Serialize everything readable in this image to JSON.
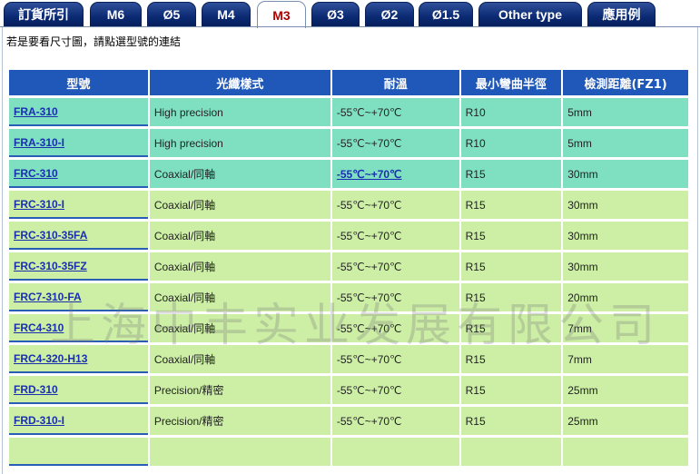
{
  "tabs": [
    {
      "label": "訂貨所引",
      "active": false
    },
    {
      "label": "M6",
      "active": false
    },
    {
      "label": "Ø5",
      "active": false
    },
    {
      "label": "M4",
      "active": false
    },
    {
      "label": "M3",
      "active": true
    },
    {
      "label": "Ø3",
      "active": false
    },
    {
      "label": "Ø2",
      "active": false
    },
    {
      "label": "Ø1.5",
      "active": false
    },
    {
      "label": "Other type",
      "active": false
    },
    {
      "label": "應用例",
      "active": false
    }
  ],
  "instruction": "若是要看尺寸圖，請點選型號的連結",
  "table": {
    "headers": [
      "型號",
      "光纖樣式",
      "耐溫",
      "最小彎曲半徑",
      "檢測距離(FZ1)"
    ],
    "rows": [
      {
        "model": "FRA-310",
        "fiber": "High precision",
        "temp": "-55℃~+70℃",
        "bend": "R10",
        "dist": "5mm"
      },
      {
        "model": "FRA-310-I",
        "fiber": "High precision",
        "temp": "-55℃~+70℃",
        "bend": "R10",
        "dist": "5mm"
      },
      {
        "model": "FRC-310",
        "fiber": "Coaxial/同軸",
        "temp": "-55℃~+70℃",
        "bend": "R15",
        "dist": "30mm"
      },
      {
        "model": "FRC-310-I",
        "fiber": "Coaxial/同軸",
        "temp": "-55℃~+70℃",
        "bend": "R15",
        "dist": "30mm"
      },
      {
        "model": "FRC-310-35FA",
        "fiber": "Coaxial/同軸",
        "temp": "-55℃~+70℃",
        "bend": "R15",
        "dist": "30mm"
      },
      {
        "model": "FRC-310-35FZ",
        "fiber": "Coaxial/同軸",
        "temp": "-55℃~+70℃",
        "bend": "R15",
        "dist": "30mm"
      },
      {
        "model": "FRC7-310-FA",
        "fiber": "Coaxial/同軸",
        "temp": "-55℃~+70℃",
        "bend": "R15",
        "dist": "20mm"
      },
      {
        "model": "FRC4-310",
        "fiber": "Coaxial/同軸",
        "temp": "-55℃~+70℃",
        "bend": "R15",
        "dist": "7mm"
      },
      {
        "model": "FRC4-320-H13",
        "fiber": "Coaxial/同軸",
        "temp": "-55℃~+70℃",
        "bend": "R15",
        "dist": "7mm"
      },
      {
        "model": "FRD-310",
        "fiber": "Precision/精密",
        "temp": "-55℃~+70℃",
        "bend": "R15",
        "dist": "25mm"
      },
      {
        "model": "FRD-310-I",
        "fiber": "Precision/精密",
        "temp": "-55℃~+70℃",
        "bend": "R15",
        "dist": "25mm"
      }
    ]
  },
  "watermark": "上海中丰实业发展有限公司",
  "colors": {
    "tab_bg": "#0b2a73",
    "active_tab_text": "#b00000",
    "header_bg": "#1f58b8",
    "row_teal": "#7fe0c1",
    "row_green": "#ccefa5",
    "link": "#1a2fb0"
  }
}
